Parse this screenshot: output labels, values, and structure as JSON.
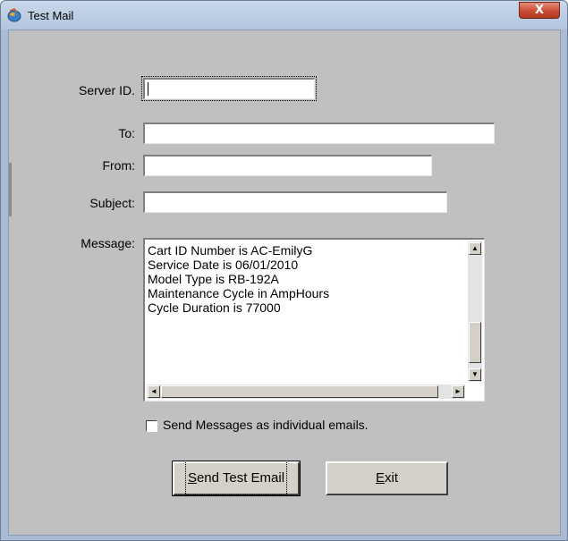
{
  "window": {
    "title": "Test Mail",
    "close_glyph": "X",
    "icon": "mail-app-icon"
  },
  "form": {
    "server_id": {
      "label": "Server ID.",
      "value": ""
    },
    "to": {
      "label": "To:",
      "value": ""
    },
    "from": {
      "label": "From:",
      "value": ""
    },
    "subject": {
      "label": "Subject:",
      "value": ""
    },
    "message": {
      "label": "Message:",
      "lines": [
        "Cart ID Number is AC-EmilyG",
        "Service Date is 06/01/2010",
        "Model Type is RB-192A",
        "Maintenance Cycle in AmpHours",
        "Cycle Duration is 77000"
      ]
    },
    "individual_emails": {
      "label": "Send Messages as individual emails.",
      "checked": false
    }
  },
  "buttons": {
    "send": {
      "accel": "S",
      "rest": "end Test Email"
    },
    "exit": {
      "accel": "E",
      "rest": "xit"
    }
  },
  "colors": {
    "window_frame": "#a9bcd4",
    "client_bg": "#c0c0c0",
    "close_red": "#c94b32"
  }
}
